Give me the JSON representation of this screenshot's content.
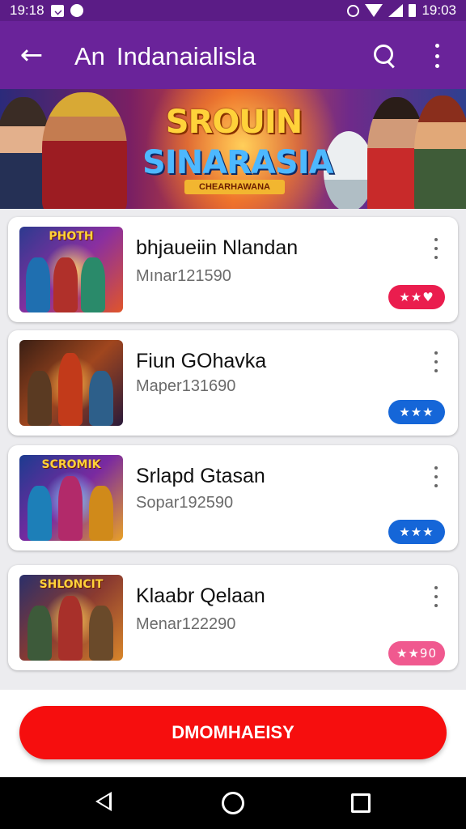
{
  "status_bar": {
    "time_left": "19:18",
    "time_right": "19:03",
    "icons": [
      "notification-box-icon",
      "notification-round-icon",
      "alarm-icon",
      "wifi-icon",
      "signal-icon",
      "battery-icon"
    ]
  },
  "app_bar": {
    "title_prefix": "An",
    "title": "Indanaialisla",
    "back_icon": "back-arrow-icon",
    "search_icon": "search-icon",
    "menu_icon": "more-vert-icon"
  },
  "banner": {
    "line1": "SROUIN",
    "line2": "SINARASIA",
    "ribbon": "CHEARHAWANA"
  },
  "games": [
    {
      "title": "bhjaueiin Nlandan",
      "subtitle": "Mınar121590",
      "thumb_text": "PHOTH",
      "badge": "★★♥",
      "badge_color": "#ea1d4e"
    },
    {
      "title": "Fiun GOhavka",
      "subtitle": "Maper131690",
      "thumb_text": "",
      "badge": "★★★",
      "badge_color": "#1566d8"
    },
    {
      "title": "Srlapd Gtasan",
      "subtitle": "Sopar192590",
      "thumb_text": "SCROMIK",
      "badge": "★★★",
      "badge_color": "#1566d8"
    },
    {
      "title": "Klaabr Qelaan",
      "subtitle": "Menar122290",
      "thumb_text": "SHLONCIT",
      "badge": "★★90",
      "badge_color": "#f0598f"
    }
  ],
  "cta": {
    "label": "DMOMHAEISY",
    "color": "#f60e0e"
  },
  "nav": {
    "back": "nav-back-icon",
    "home": "nav-home-icon",
    "recents": "nav-recents-icon"
  },
  "colors": {
    "primary": "#6a239a",
    "status_bar": "#5b1c86"
  }
}
